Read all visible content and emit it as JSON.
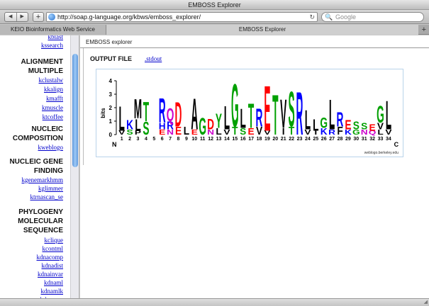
{
  "window": {
    "title": "EMBOSS Explorer"
  },
  "toolbar": {
    "back_icon": "back-arrow-icon",
    "forward_icon": "forward-arrow-icon",
    "back_glyph": "◀",
    "forward_glyph": "▶",
    "new_tab_glyph": "+",
    "url": "http://soap.g-language.org/kbws/emboss_explorer/",
    "reload_glyph": "↻",
    "search_glyph": "🔍",
    "search_placeholder": "Google"
  },
  "tabs": [
    {
      "label": "KEIO Bioinformatics Web Service",
      "active": false
    },
    {
      "label": "EMBOSS Explorer",
      "active": true
    }
  ],
  "tabbar": {
    "add_glyph": "+"
  },
  "sidebar": {
    "links_top": [
      "kblast",
      "kssearch"
    ],
    "sections": [
      {
        "title": [
          "ALIGNMENT",
          "MULTIPLE"
        ],
        "items": [
          "kclustalw",
          "kkalign",
          "kmafft",
          "kmuscle",
          "ktcoffee"
        ]
      },
      {
        "title": [
          "NUCLEIC",
          "COMPOSITION"
        ],
        "items": [
          "kweblogo"
        ]
      },
      {
        "title": [
          "NUCLEIC GENE",
          "FINDING"
        ],
        "items": [
          "kgenemarkhmm",
          "kglimmer",
          "ktrnascan_se"
        ]
      },
      {
        "title": [
          "PHYLOGENY",
          "MOLECULAR",
          "SEQUENCE"
        ],
        "items": [
          "kclique",
          "kcontml",
          "kdnacomp",
          "kdnadist",
          "kdnainvar",
          "kdnaml",
          "kdnamlk",
          "kdnapars"
        ]
      }
    ]
  },
  "main": {
    "app_title": "EMBOSS explorer",
    "output_heading": "OUTPUT FILE",
    "output_link": ".stdout"
  },
  "logo": {
    "y_label": "bits",
    "y_ticks": [
      "0",
      "1",
      "2",
      "3",
      "4"
    ],
    "n_label": "N",
    "c_label": "C",
    "credit": "weblogo.berkeley.edu",
    "positions": [
      {
        "pos": 1,
        "letters": [
          {
            "c": "L",
            "bits": 1.9,
            "color": "#000000"
          },
          {
            "c": "V",
            "bits": 0.3,
            "color": "#000000"
          }
        ]
      },
      {
        "pos": 2,
        "letters": [
          {
            "c": "K",
            "bits": 0.7,
            "color": "#0000ff"
          },
          {
            "c": "S",
            "bits": 0.4,
            "color": "#00a000"
          }
        ]
      },
      {
        "pos": 3,
        "letters": [
          {
            "c": "M",
            "bits": 1.5,
            "color": "#000000"
          },
          {
            "c": "L",
            "bits": 0.9,
            "color": "#000000"
          },
          {
            "c": "P",
            "bits": 0.3,
            "color": "#000000"
          }
        ]
      },
      {
        "pos": 4,
        "letters": [
          {
            "c": "T",
            "bits": 1.5,
            "color": "#00a000"
          },
          {
            "c": "S",
            "bits": 1.0,
            "color": "#00a000"
          }
        ]
      },
      {
        "pos": 5,
        "letters": []
      },
      {
        "pos": 6,
        "letters": [
          {
            "c": "R",
            "bits": 1.9,
            "color": "#0000ff"
          },
          {
            "c": "H",
            "bits": 0.5,
            "color": "#0000ff"
          },
          {
            "c": "E",
            "bits": 0.4,
            "color": "#ff0000"
          }
        ]
      },
      {
        "pos": 7,
        "letters": [
          {
            "c": "Q",
            "bits": 1.0,
            "color": "#cc00cc"
          },
          {
            "c": "R",
            "bits": 0.6,
            "color": "#0000ff"
          },
          {
            "c": "N",
            "bits": 0.4,
            "color": "#cc00cc"
          }
        ]
      },
      {
        "pos": 8,
        "letters": [
          {
            "c": "D",
            "bits": 1.9,
            "color": "#ff0000"
          },
          {
            "c": "E",
            "bits": 0.6,
            "color": "#ff0000"
          }
        ]
      },
      {
        "pos": 9,
        "letters": [
          {
            "c": "L",
            "bits": 0.6,
            "color": "#000000"
          }
        ]
      },
      {
        "pos": 10,
        "letters": [
          {
            "c": "A",
            "bits": 2.4,
            "color": "#000000"
          },
          {
            "c": "E",
            "bits": 0.4,
            "color": "#ff0000"
          }
        ]
      },
      {
        "pos": 11,
        "letters": [
          {
            "c": "G",
            "bits": 1.3,
            "color": "#00a000"
          }
        ]
      },
      {
        "pos": 12,
        "letters": [
          {
            "c": "D",
            "bits": 0.8,
            "color": "#ff0000"
          },
          {
            "c": "N",
            "bits": 0.4,
            "color": "#cc00cc"
          }
        ]
      },
      {
        "pos": 13,
        "letters": [
          {
            "c": "Y",
            "bits": 1.1,
            "color": "#00a000"
          },
          {
            "c": "L",
            "bits": 0.5,
            "color": "#000000"
          }
        ]
      },
      {
        "pos": 14,
        "letters": [
          {
            "c": "L",
            "bits": 1.8,
            "color": "#000000"
          },
          {
            "c": "V",
            "bits": 0.4,
            "color": "#000000"
          }
        ]
      },
      {
        "pos": 15,
        "letters": [
          {
            "c": "G",
            "bits": 3.3,
            "color": "#00a000"
          },
          {
            "c": "T",
            "bits": 0.6,
            "color": "#00a000"
          }
        ]
      },
      {
        "pos": 16,
        "letters": [
          {
            "c": "L",
            "bits": 1.5,
            "color": "#000000"
          },
          {
            "c": "S",
            "bits": 0.5,
            "color": "#00a000"
          }
        ]
      },
      {
        "pos": 17,
        "letters": [
          {
            "c": "T",
            "bits": 1.9,
            "color": "#00a000"
          },
          {
            "c": "E",
            "bits": 0.5,
            "color": "#ff0000"
          }
        ]
      },
      {
        "pos": 18,
        "letters": [
          {
            "c": "R",
            "bits": 1.4,
            "color": "#0000ff"
          },
          {
            "c": "V",
            "bits": 0.6,
            "color": "#000000"
          }
        ]
      },
      {
        "pos": 19,
        "letters": [
          {
            "c": "E",
            "bits": 3.5,
            "color": "#ff0000"
          },
          {
            "c": "V",
            "bits": 0.3,
            "color": "#000000"
          }
        ]
      },
      {
        "pos": 20,
        "letters": [
          {
            "c": "T",
            "bits": 3.1,
            "color": "#00a000"
          }
        ]
      },
      {
        "pos": 21,
        "letters": [
          {
            "c": "V",
            "bits": 2.2,
            "color": "#000000"
          },
          {
            "c": "I",
            "bits": 0.5,
            "color": "#000000"
          }
        ]
      },
      {
        "pos": 22,
        "letters": [
          {
            "c": "S",
            "bits": 2.7,
            "color": "#00a000"
          },
          {
            "c": "T",
            "bits": 0.6,
            "color": "#00a000"
          }
        ]
      },
      {
        "pos": 23,
        "letters": [
          {
            "c": "R",
            "bits": 3.3,
            "color": "#0000ff"
          }
        ]
      },
      {
        "pos": 24,
        "letters": [
          {
            "c": "L",
            "bits": 1.5,
            "color": "#000000"
          },
          {
            "c": "V",
            "bits": 0.4,
            "color": "#000000"
          }
        ]
      },
      {
        "pos": 25,
        "letters": [
          {
            "c": "L",
            "bits": 0.9,
            "color": "#000000"
          },
          {
            "c": "I",
            "bits": 0.3,
            "color": "#000000"
          }
        ]
      },
      {
        "pos": 26,
        "letters": [
          {
            "c": "G",
            "bits": 0.8,
            "color": "#00a000"
          },
          {
            "c": "K",
            "bits": 0.5,
            "color": "#0000ff"
          }
        ]
      },
      {
        "pos": 27,
        "letters": [
          {
            "c": "L",
            "bits": 2.3,
            "color": "#000000"
          },
          {
            "c": "R",
            "bits": 0.4,
            "color": "#0000ff"
          }
        ]
      },
      {
        "pos": 28,
        "letters": [
          {
            "c": "R",
            "bits": 1.1,
            "color": "#0000ff"
          },
          {
            "c": "F",
            "bits": 0.6,
            "color": "#000000"
          }
        ]
      },
      {
        "pos": 29,
        "letters": [
          {
            "c": "E",
            "bits": 0.7,
            "color": "#ff0000"
          },
          {
            "c": "K",
            "bits": 0.4,
            "color": "#0000ff"
          }
        ]
      },
      {
        "pos": 30,
        "letters": [
          {
            "c": "S",
            "bits": 0.6,
            "color": "#00a000"
          },
          {
            "c": "G",
            "bits": 0.4,
            "color": "#00a000"
          }
        ]
      },
      {
        "pos": 31,
        "letters": [
          {
            "c": "S",
            "bits": 0.5,
            "color": "#00a000"
          },
          {
            "c": "N",
            "bits": 0.4,
            "color": "#cc00cc"
          }
        ]
      },
      {
        "pos": 32,
        "letters": [
          {
            "c": "E",
            "bits": 0.5,
            "color": "#ff0000"
          },
          {
            "c": "Q",
            "bits": 0.3,
            "color": "#cc00cc"
          }
        ]
      },
      {
        "pos": 33,
        "letters": [
          {
            "c": "G",
            "bits": 1.3,
            "color": "#00a000"
          },
          {
            "c": "V",
            "bits": 0.5,
            "color": "#000000"
          },
          {
            "c": "L",
            "bits": 0.4,
            "color": "#000000"
          }
        ]
      },
      {
        "pos": 34,
        "letters": [
          {
            "c": "L",
            "bits": 2.2,
            "color": "#000000"
          },
          {
            "c": "V",
            "bits": 0.4,
            "color": "#000000"
          }
        ]
      }
    ]
  }
}
